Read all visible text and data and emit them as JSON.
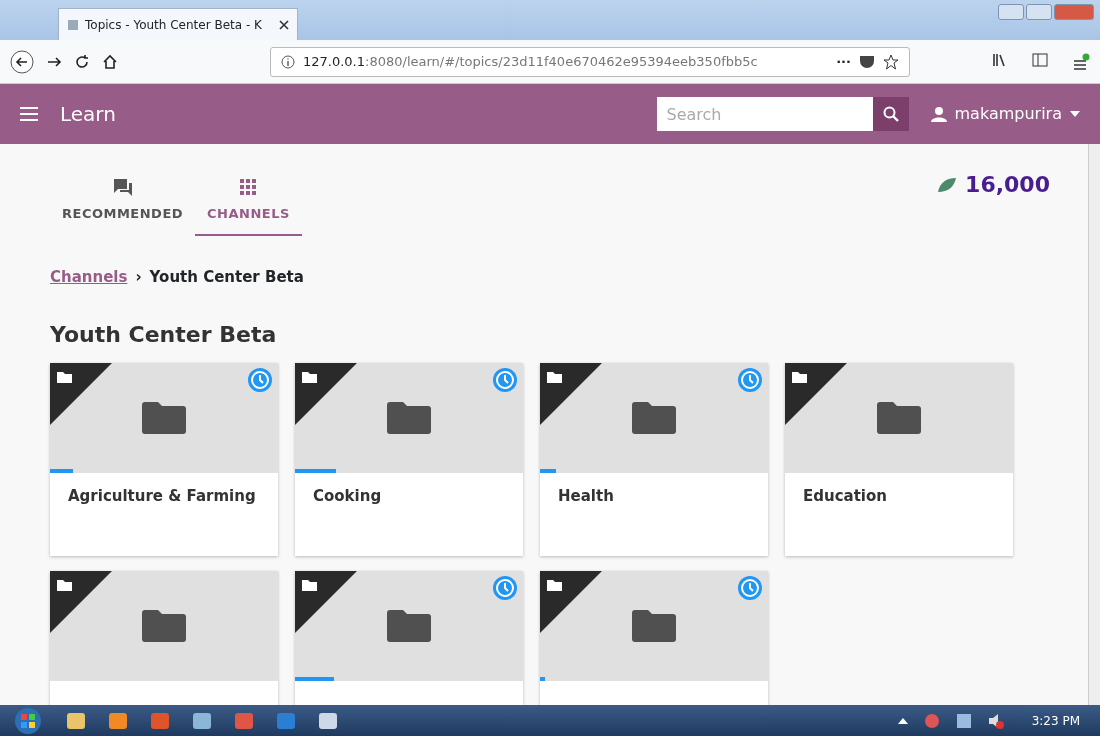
{
  "browser": {
    "tab_title": "Topics - Youth Center Beta - K",
    "url_host": "127.0.0.1",
    "url_rest": ":8080/learn/#/topics/23d11f40e670462e95394eeb350fbb5c",
    "menu_dots": "···"
  },
  "app_bar": {
    "title": "Learn",
    "search": {
      "placeholder": "Search"
    },
    "user": "makampurira"
  },
  "tabs": [
    {
      "label": "RECOMMENDED",
      "kind": "chat",
      "selected": false
    },
    {
      "label": "CHANNELS",
      "kind": "grid",
      "selected": true
    }
  ],
  "points": "16,000",
  "breadcrumb": {
    "link": "Channels",
    "separator": "›",
    "current": "Youth Center Beta"
  },
  "heading": "Youth Center Beta",
  "cards": [
    {
      "title": "Agriculture & Farming",
      "in_progress": true,
      "level": 0.1
    },
    {
      "title": "Cooking",
      "in_progress": true,
      "level": 0.18
    },
    {
      "title": "Health",
      "in_progress": true,
      "level": 0.07
    },
    {
      "title": "Education",
      "in_progress": false
    },
    {
      "in_progress": false
    },
    {
      "in_progress": true,
      "level": 0.17
    },
    {
      "in_progress": true,
      "level": 0.02
    }
  ],
  "taskbar": {
    "time": "3:23 PM"
  }
}
